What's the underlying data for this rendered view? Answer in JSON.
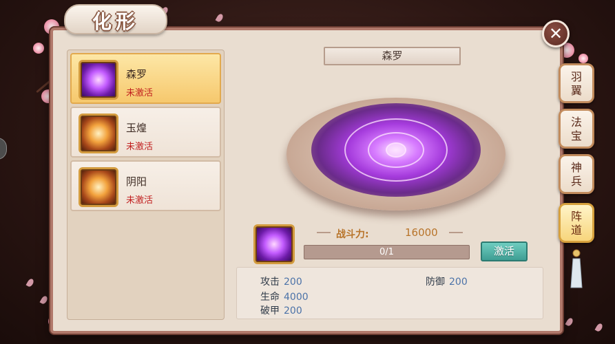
{
  "title": "化形",
  "list": [
    {
      "name": "森罗",
      "status": "未激活",
      "icon": "purple-array-icon",
      "selected": true
    },
    {
      "name": "玉煌",
      "status": "未激活",
      "icon": "gold-array-icon",
      "selected": false
    },
    {
      "name": "阴阳",
      "status": "未激活",
      "icon": "gold-array-icon",
      "selected": false
    }
  ],
  "detail": {
    "name": "森罗",
    "power_label": "战斗力:",
    "power_value": "16000",
    "progress_text": "0/1",
    "progress_fraction": 0.0,
    "activate_label": "激活"
  },
  "attributes": {
    "attack_label": "攻击",
    "attack_value": "200",
    "defense_label": "防御",
    "defense_value": "200",
    "hp_label": "生命",
    "hp_value": "4000",
    "pierce_label": "破甲",
    "pierce_value": "200"
  },
  "side_tabs": [
    {
      "label": "羽翼",
      "active": false
    },
    {
      "label": "法宝",
      "active": false
    },
    {
      "label": "神兵",
      "active": false
    },
    {
      "label": "阵道",
      "active": true
    }
  ],
  "colors": {
    "accent_gold": "#f6c86d",
    "status_red": "#c11f1f",
    "button_teal": "#3e9e93",
    "frame_brown": "#b0786a"
  }
}
